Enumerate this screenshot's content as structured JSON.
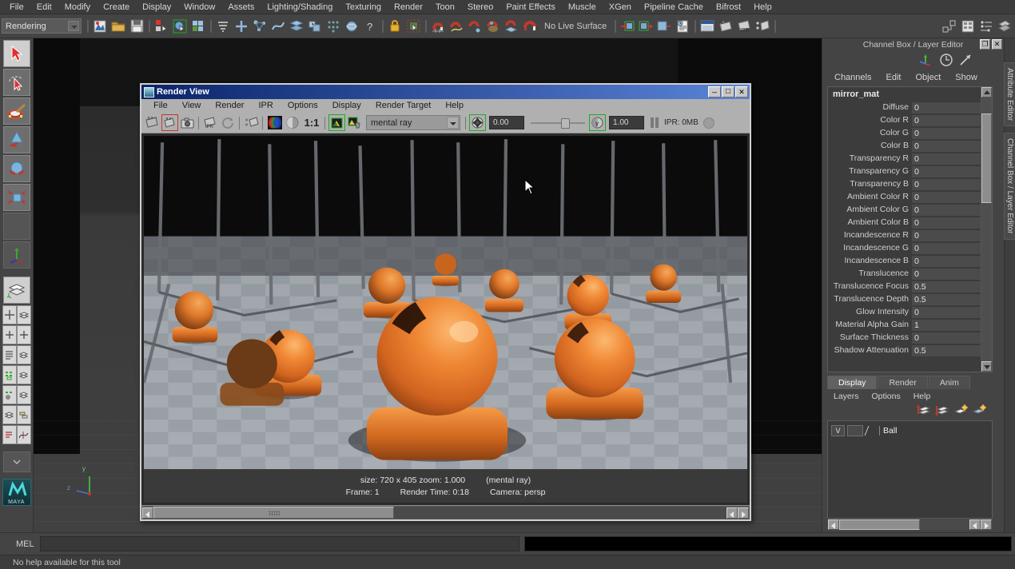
{
  "app": {
    "menubar": [
      "File",
      "Edit",
      "Modify",
      "Create",
      "Display",
      "Window",
      "Assets",
      "Lighting/Shading",
      "Texturing",
      "Render",
      "Toon",
      "Stereo",
      "Paint Effects",
      "Muscle",
      "XGen",
      "Pipeline Cache",
      "Bifrost",
      "Help"
    ],
    "menu_set": "Rendering",
    "live_surface": "No Live Surface",
    "mel_label": "MEL",
    "status_text": "No help available for this tool",
    "viewport_axis": {
      "y": "y",
      "z": "z"
    }
  },
  "toolbox": {
    "tools": [
      {
        "name": "select-tool",
        "icon": "arrow-cursor-icon"
      },
      {
        "name": "lasso-tool",
        "icon": "lasso-icon"
      },
      {
        "name": "paint-select-tool",
        "icon": "paint-brush-icon"
      },
      {
        "name": "move-tool",
        "icon": "move-arrow-icon"
      },
      {
        "name": "rotate-tool",
        "icon": "rotate-icon"
      },
      {
        "name": "scale-tool",
        "icon": "scale-icon"
      },
      {
        "name": "last-tool",
        "icon": "axis-icon"
      }
    ],
    "logo": "MAYA"
  },
  "render_view": {
    "title": "Render View",
    "menubar": [
      "File",
      "View",
      "Render",
      "IPR",
      "Options",
      "Display",
      "Render Target",
      "Help"
    ],
    "toolbar": {
      "renderer": "mental ray",
      "exposure_value": "0.00",
      "gamma_value": "1.00",
      "ipr_label": "IPR: 0MB",
      "buttons": [
        {
          "name": "render-region-button",
          "icon": "clapper-icon"
        },
        {
          "name": "render-current-frame-button",
          "icon": "clapper-red-icon"
        },
        {
          "name": "snapshot-button",
          "icon": "camera-icon"
        },
        {
          "name": "ipr-render-button",
          "icon": "ipr-clapper-icon"
        },
        {
          "name": "refresh-button",
          "icon": "refresh-icon"
        },
        {
          "name": "render-region-select-button",
          "icon": "region-clapper-icon"
        },
        {
          "name": "rgb-channel-button",
          "icon": "rgb-sphere-icon"
        },
        {
          "name": "alpha-channel-button",
          "icon": "alpha-sphere-icon"
        },
        {
          "name": "zoom-reset-button",
          "icon": "one-to-one-icon"
        },
        {
          "name": "keep-image-button",
          "icon": "keep-image-icon"
        },
        {
          "name": "remove-image-button",
          "icon": "remove-image-icon"
        }
      ]
    },
    "status": {
      "size": "size: 720 x 405 zoom: 1.000",
      "renderer": "(mental ray)",
      "frame": "Frame: 1",
      "render_time": "Render Time: 0:18",
      "camera": "Camera: persp"
    },
    "window_buttons": [
      "minimize",
      "maximize",
      "close"
    ]
  },
  "scene": {
    "description": "hall-of-mirrors render of orange spheres on bases over a grey checkered floor",
    "colors": {
      "sphere": "#e2722a",
      "sphere_highlight": "#f8a55a",
      "sphere_dark": "#5a2c16",
      "floor_light": "#a9aeb3",
      "floor_dark": "#8f959b",
      "background": "#0a0a0a",
      "mirror_frame": "#4a4a4a"
    }
  },
  "channel_box": {
    "panel_title": "Channel Box / Layer Editor",
    "menubar": [
      "Channels",
      "Edit",
      "Object",
      "Show"
    ],
    "node_name": "mirror_mat",
    "attributes": [
      {
        "label": "Diffuse",
        "value": "0"
      },
      {
        "label": "Color R",
        "value": "0"
      },
      {
        "label": "Color G",
        "value": "0"
      },
      {
        "label": "Color B",
        "value": "0"
      },
      {
        "label": "Transparency R",
        "value": "0"
      },
      {
        "label": "Transparency G",
        "value": "0"
      },
      {
        "label": "Transparency B",
        "value": "0"
      },
      {
        "label": "Ambient Color R",
        "value": "0"
      },
      {
        "label": "Ambient Color G",
        "value": "0"
      },
      {
        "label": "Ambient Color B",
        "value": "0"
      },
      {
        "label": "Incandescence R",
        "value": "0"
      },
      {
        "label": "Incandescence G",
        "value": "0"
      },
      {
        "label": "Incandescence B",
        "value": "0"
      },
      {
        "label": "Translucence",
        "value": "0"
      },
      {
        "label": "Translucence Focus",
        "value": "0.5"
      },
      {
        "label": "Translucence Depth",
        "value": "0.5"
      },
      {
        "label": "Glow Intensity",
        "value": "0"
      },
      {
        "label": "Material Alpha Gain",
        "value": "1"
      },
      {
        "label": "Surface Thickness",
        "value": "0"
      },
      {
        "label": "Shadow Attenuation",
        "value": "0.5"
      }
    ]
  },
  "layer_editor": {
    "tabs": [
      "Display",
      "Render",
      "Anim"
    ],
    "active_tab": "Display",
    "menubar": [
      "Layers",
      "Options",
      "Help"
    ],
    "layers": [
      {
        "visibility": "V",
        "playback": "",
        "name": "Ball"
      }
    ],
    "icons": [
      "move-layer-up-icon",
      "move-layer-down-icon",
      "new-layer-icon",
      "new-layer-from-selected-icon"
    ]
  },
  "side_tabs": [
    "Attribute Editor",
    "Channel Box / Layer Editor"
  ]
}
